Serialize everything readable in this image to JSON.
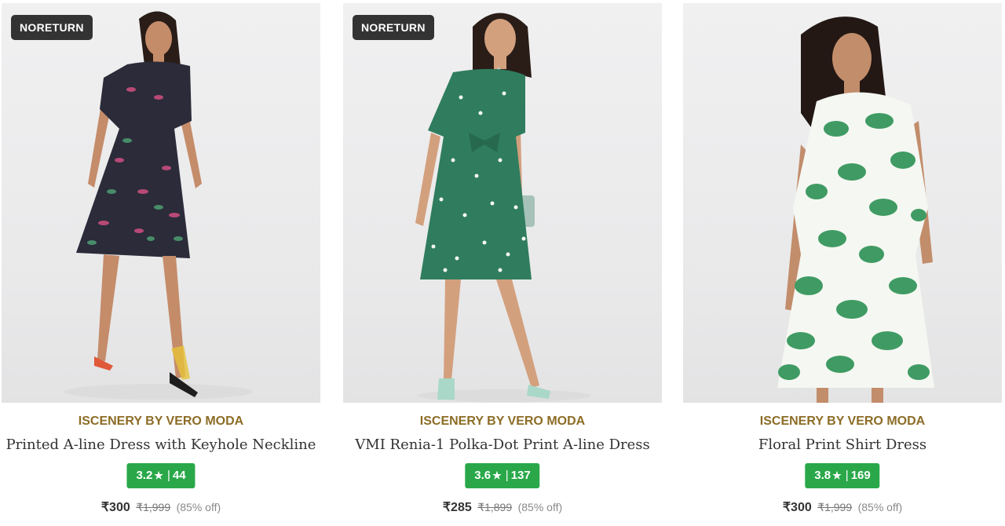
{
  "products": [
    {
      "badge": "NORETURN",
      "brand": "ISCENERY BY VERO MODA",
      "title": "Printed A-line Dress with Keyhole Neckline",
      "rating": "3.2",
      "reviews": "44",
      "price": "₹300",
      "mrp": "₹1,999",
      "discount": "(85% off)",
      "image": "model-wearing-dark-printed-dress"
    },
    {
      "badge": "NORETURN",
      "brand": "ISCENERY BY VERO MODA",
      "title": "VMI Renia-1 Polka-Dot Print A-line Dress",
      "rating": "3.6",
      "reviews": "137",
      "price": "₹285",
      "mrp": "₹1,899",
      "discount": "(85% off)",
      "image": "model-wearing-green-polka-dot-dress"
    },
    {
      "brand": "ISCENERY BY VERO MODA",
      "title": "Floral Print Shirt Dress",
      "rating": "3.8",
      "reviews": "169",
      "price": "₹300",
      "mrp": "₹1,999",
      "discount": "(85% off)",
      "image": "model-wearing-green-floral-shirt-dress"
    }
  ],
  "colors": {
    "brand": "#8c6c26",
    "rating_bg": "#2aa849",
    "badge_bg": "#333333"
  },
  "icons": {
    "rating_star": "star-icon"
  }
}
